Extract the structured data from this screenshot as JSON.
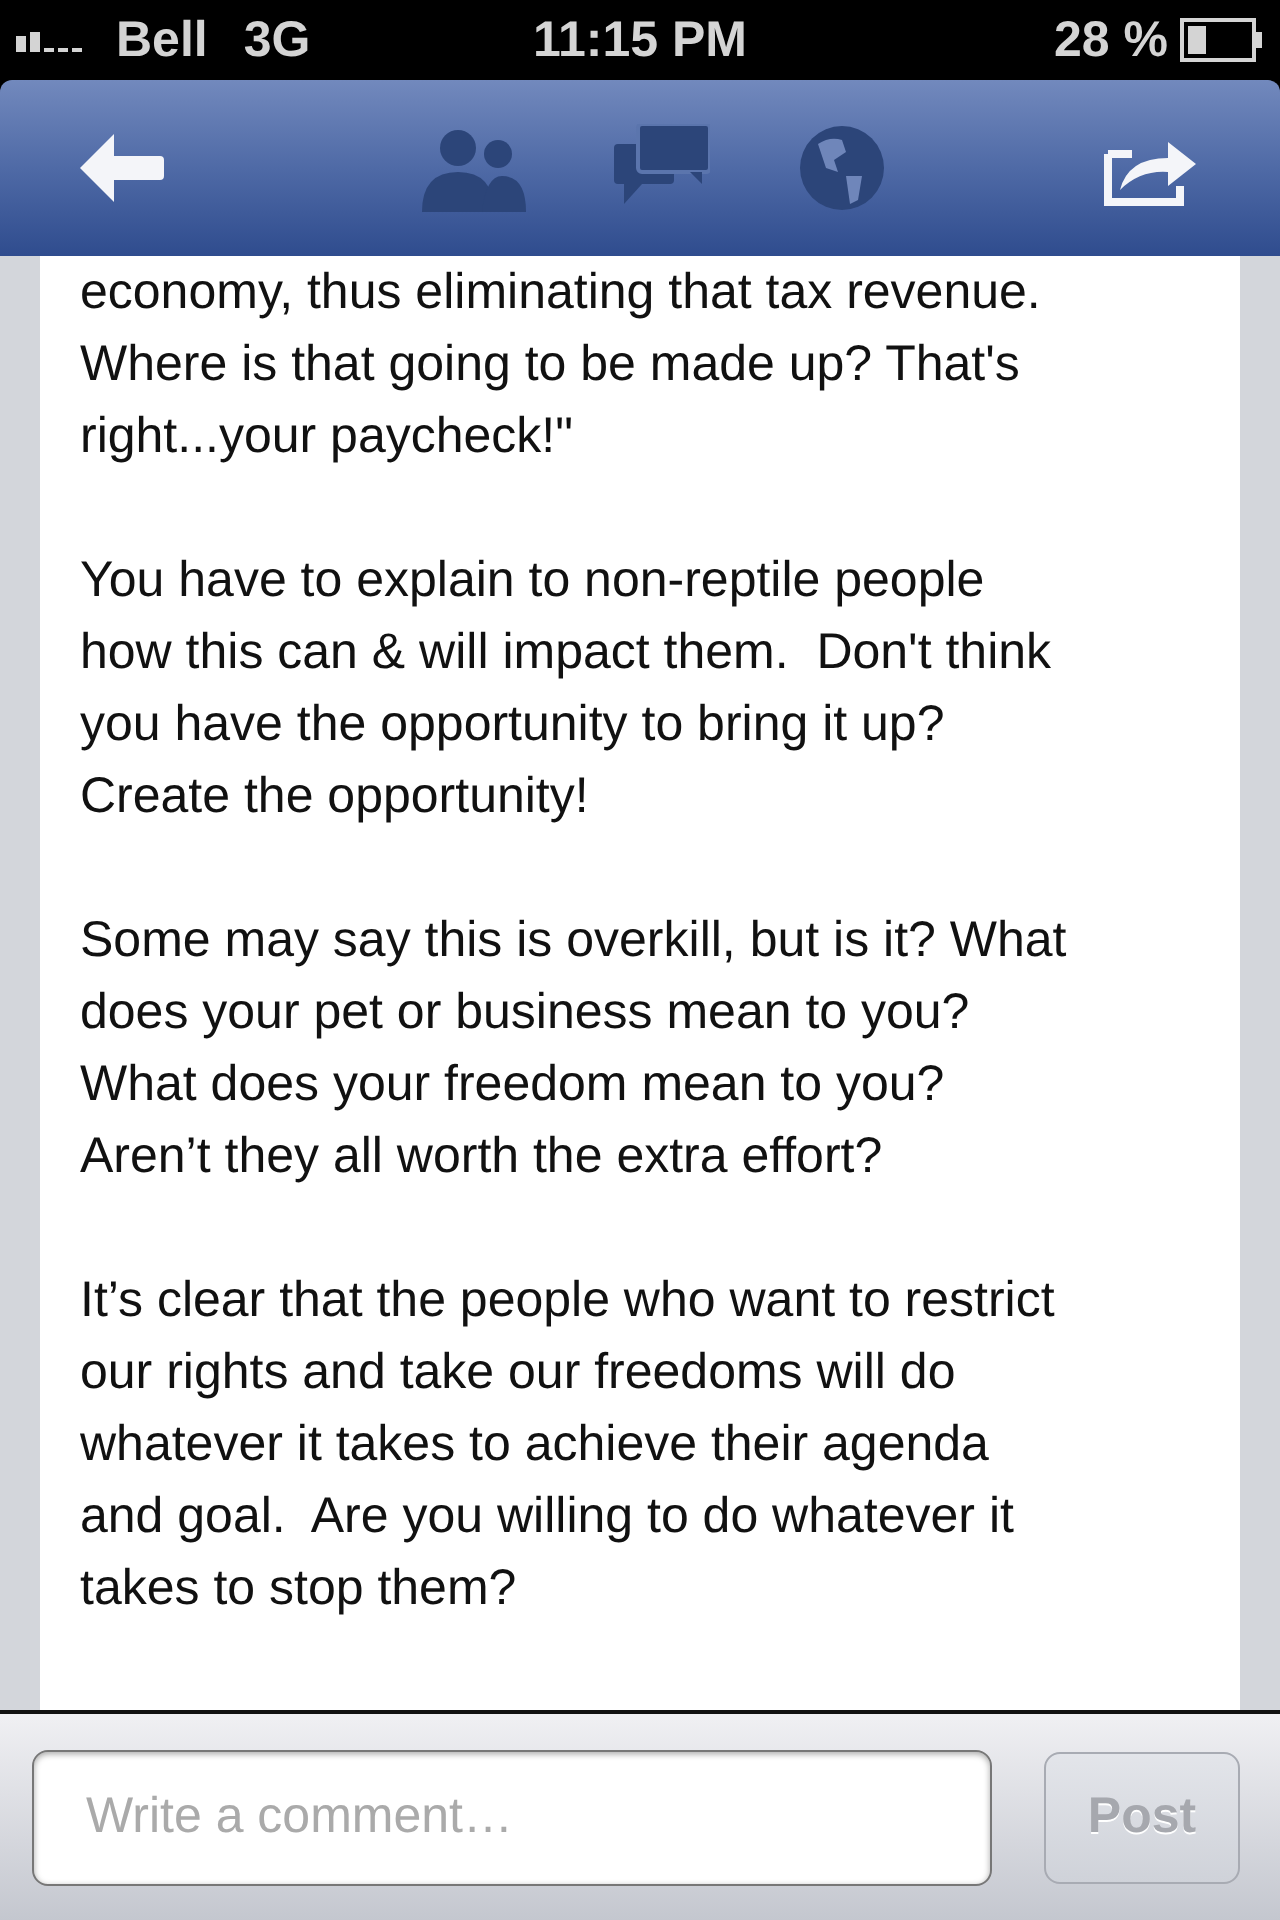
{
  "status_bar": {
    "carrier": "Bell",
    "network": "3G",
    "time": "11:15 PM",
    "battery": "28 %"
  },
  "post": {
    "paragraphs": [
      "economy, thus eliminating that tax revenue.\nWhere is that going to be made up? That's\nright...your paycheck!\"",
      "You have to explain to non-reptile people\nhow this can & will impact them.  Don't think\nyou have the opportunity to bring it up?\nCreate the opportunity!",
      "Some may say this is overkill, but is it? What\ndoes your pet or business mean to you?\nWhat does your freedom mean to you?\nAren’t they all worth the extra effort?",
      "It’s clear that the people who want to restrict\nour rights and take our freedoms will do\nwhatever it takes to achieve their agenda\nand goal.  Are you willing to do whatever it\ntakes to stop them?"
    ]
  },
  "comment_bar": {
    "placeholder": "Write a comment…",
    "button": "Post",
    "button_disabled": true
  }
}
